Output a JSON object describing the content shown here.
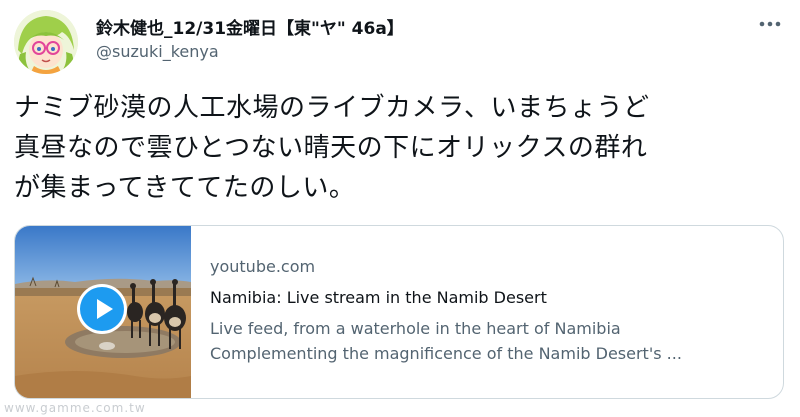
{
  "tweet": {
    "display_name": "鈴木健也_12/31金曜日【東\"ヤ\" 46a】",
    "handle": "@suzuki_kenya",
    "text_lines": [
      "ナミブ砂漠の人工水場のライブカメラ、いまちょうど",
      "真昼なので雲ひとつない晴天の下にオリックスの群れ",
      "が集まってきててたのしい。"
    ]
  },
  "card": {
    "domain": "youtube.com",
    "title": "Namibia: Live stream in the Namib Desert",
    "description_lines": [
      "Live feed, from a waterhole in the heart of Namibia",
      "Complementing the magnificence of the Namib Desert's ..."
    ],
    "play_icon": "play-icon"
  },
  "watermark": "www.gamme.com.tw",
  "colors": {
    "text": "#0f1419",
    "secondary": "#536471",
    "border": "#cfd9de",
    "play_blue": "#1d9bf0"
  }
}
